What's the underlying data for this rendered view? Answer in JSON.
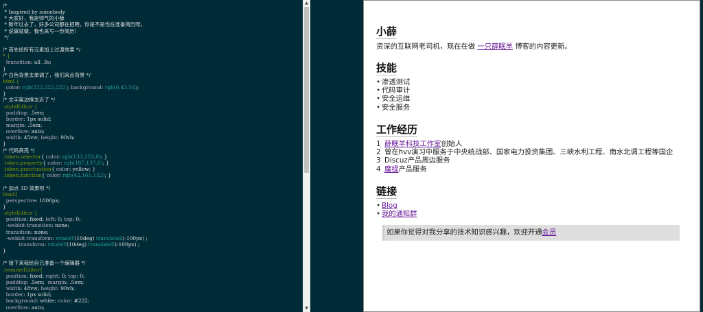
{
  "editor": {
    "lines": [
      [
        [
          "/*",
          "com"
        ]
      ],
      [
        [
          " * Inspired by somebody",
          "com"
        ]
      ],
      [
        [
          " * 大家好，我是帅气的小薛",
          "com"
        ]
      ],
      [
        [
          " * 新年过去了，好多公司都在招聘，你是不是也在准备简历呀。",
          "com"
        ]
      ],
      [
        [
          " * 说做就做，我也来写一份简历!",
          "com"
        ]
      ],
      [
        [
          " */",
          "com"
        ]
      ],
      [
        [
          "",
          "pun"
        ]
      ],
      [
        [
          "/* 首先给所有元素加上过渡效果 */",
          "com"
        ]
      ],
      [
        [
          "* {",
          "sel"
        ]
      ],
      [
        [
          "  transition",
          "prop"
        ],
        [
          ": all .3s;",
          "pun"
        ]
      ],
      [
        [
          "}",
          "pun"
        ]
      ],
      [
        [
          "/* 白色背景太单调了，我们来点背景 */",
          "com"
        ]
      ],
      [
        [
          "html {",
          "sel"
        ]
      ],
      [
        [
          "  color",
          "prop"
        ],
        [
          ": ",
          "pun"
        ],
        [
          "rgb(222,222,222)",
          "fn"
        ],
        [
          "; ",
          "pun"
        ],
        [
          "background",
          "prop"
        ],
        [
          ": ",
          "pun"
        ],
        [
          "rgb(0,43,54)",
          "fn"
        ],
        [
          ";",
          "pun"
        ]
      ],
      [
        [
          "}",
          "pun"
        ]
      ],
      [
        [
          "/* 文字离边框太近了 */",
          "com"
        ]
      ],
      [
        [
          ".styleEditor {",
          "sel"
        ]
      ],
      [
        [
          "  padding",
          "prop"
        ],
        [
          ": .5em;",
          "pun"
        ]
      ],
      [
        [
          "  border",
          "prop"
        ],
        [
          ": 1px solid;",
          "pun"
        ]
      ],
      [
        [
          "  margin",
          "prop"
        ],
        [
          ": .5em;",
          "pun"
        ]
      ],
      [
        [
          "  overflow",
          "prop"
        ],
        [
          ": auto;",
          "pun"
        ]
      ],
      [
        [
          "  width",
          "prop"
        ],
        [
          ": 45vw; ",
          "pun"
        ],
        [
          "height",
          "prop"
        ],
        [
          ": 90vh;",
          "pun"
        ]
      ],
      [
        [
          "}",
          "pun"
        ]
      ],
      [
        [
          "/* 代码高亮 */",
          "com"
        ]
      ],
      [
        [
          ".token.selector",
          "sel"
        ],
        [
          "{ ",
          "pun"
        ],
        [
          "color",
          "prop"
        ],
        [
          ": ",
          "pun"
        ],
        [
          "rgb(133,153,0)",
          "fn"
        ],
        [
          "; }",
          "pun"
        ]
      ],
      [
        [
          ".token.property",
          "sel"
        ],
        [
          "{ ",
          "pun"
        ],
        [
          "color",
          "prop"
        ],
        [
          ": ",
          "pun"
        ],
        [
          "rgb(187,137,0)",
          "fn"
        ],
        [
          "; }",
          "pun"
        ]
      ],
      [
        [
          ".token.punctuation",
          "sel"
        ],
        [
          "{ ",
          "pun"
        ],
        [
          "color",
          "prop"
        ],
        [
          ": yellow; }",
          "pun"
        ]
      ],
      [
        [
          ".token.function",
          "sel"
        ],
        [
          "{ ",
          "pun"
        ],
        [
          "color",
          "prop"
        ],
        [
          ": ",
          "pun"
        ],
        [
          "rgb(42,161,152)",
          "fn"
        ],
        [
          "; }",
          "pun"
        ]
      ],
      [
        [
          "",
          "pun"
        ]
      ],
      [
        [
          "/* 加点 3D 效果呗 */",
          "com"
        ]
      ],
      [
        [
          "html{",
          "sel"
        ]
      ],
      [
        [
          "  perspective",
          "prop"
        ],
        [
          ": 1000px;",
          "pun"
        ]
      ],
      [
        [
          "}",
          "pun"
        ]
      ],
      [
        [
          ".styleEditor {",
          "sel"
        ]
      ],
      [
        [
          "  position",
          "prop"
        ],
        [
          ": fixed; ",
          "pun"
        ],
        [
          "left",
          "prop"
        ],
        [
          ": 0; ",
          "pun"
        ],
        [
          "top",
          "prop"
        ],
        [
          ": 0;",
          "pun"
        ]
      ],
      [
        [
          "  -webkit-transition",
          "prop"
        ],
        [
          ": none;",
          "pun"
        ]
      ],
      [
        [
          "  transition",
          "prop"
        ],
        [
          ": none;",
          "pun"
        ]
      ],
      [
        [
          "  -webkit-transform",
          "prop"
        ],
        [
          ": ",
          "pun"
        ],
        [
          "rotateY",
          "fn"
        ],
        [
          "(10deg) ",
          "pun"
        ],
        [
          "translateZ",
          "fn"
        ],
        [
          "(-100px) ;",
          "pun"
        ]
      ],
      [
        [
          "          transform",
          "prop"
        ],
        [
          ": ",
          "pun"
        ],
        [
          "rotateY",
          "fn"
        ],
        [
          "(10deg) ",
          "pun"
        ],
        [
          "translateZ",
          "fn"
        ],
        [
          "(-100px) ;",
          "pun"
        ]
      ],
      [
        [
          "}",
          "pun"
        ]
      ],
      [
        [
          "",
          "pun"
        ]
      ],
      [
        [
          "/* 接下来我给自己准备一个编辑器 */",
          "com"
        ]
      ],
      [
        [
          ".resumeEditor{",
          "sel"
        ]
      ],
      [
        [
          "  position",
          "prop"
        ],
        [
          ": fixed; ",
          "pun"
        ],
        [
          "right",
          "prop"
        ],
        [
          ": 0; ",
          "pun"
        ],
        [
          "top",
          "prop"
        ],
        [
          ": 0;",
          "pun"
        ]
      ],
      [
        [
          "  padding",
          "prop"
        ],
        [
          ": .5em;  ",
          "pun"
        ],
        [
          "margin",
          "prop"
        ],
        [
          ": .5em;",
          "pun"
        ]
      ],
      [
        [
          "  width",
          "prop"
        ],
        [
          ": 48vw; ",
          "pun"
        ],
        [
          "height",
          "prop"
        ],
        [
          ": 90vh;",
          "pun"
        ]
      ],
      [
        [
          "  border",
          "prop"
        ],
        [
          ": 1px solid;",
          "pun"
        ]
      ],
      [
        [
          "  background",
          "prop"
        ],
        [
          ": white; ",
          "pun"
        ],
        [
          "color",
          "prop"
        ],
        [
          ": #222;",
          "pun"
        ]
      ],
      [
        [
          "  overflow",
          "prop"
        ],
        [
          ": auto;",
          "pun"
        ]
      ]
    ]
  },
  "resume": {
    "intro_title": "小薛",
    "intro_pre": "资深的互联网老司机，现在在做 ",
    "intro_link": "一只薛眠羊",
    "intro_post": " 博客的内容更新。",
    "skills_title": "技能",
    "skills": [
      "渗透测试",
      "代码审计",
      "安全运维",
      "安全服务"
    ],
    "work_title": "工作经历",
    "work": [
      {
        "num": "1",
        "link": "薛眠羊科技工作室",
        "text": "创始人"
      },
      {
        "num": "2",
        "link": "",
        "text": "曾在hvv演习中服务于中央统战部、国家电力投资集团、三峡水利工程、南水北调工程等国企"
      },
      {
        "num": "3",
        "link": "",
        "text": "Discuz产品周边服务"
      },
      {
        "num": "4",
        "link": "魔缇",
        "text": "产品服务"
      }
    ],
    "links_title": "链接",
    "links": [
      "Blog",
      "我的通知群"
    ],
    "quote_pre": "如果你觉得对我分享的技术知识感兴趣，欢迎开通",
    "quote_link": "会员"
  },
  "colors": {
    "editor_bg": "#002b36",
    "editor_text": "#dedede",
    "selector": "#859900",
    "property": "#bbb0c5",
    "function": "#2aa198",
    "link": "#6a1b9a"
  }
}
